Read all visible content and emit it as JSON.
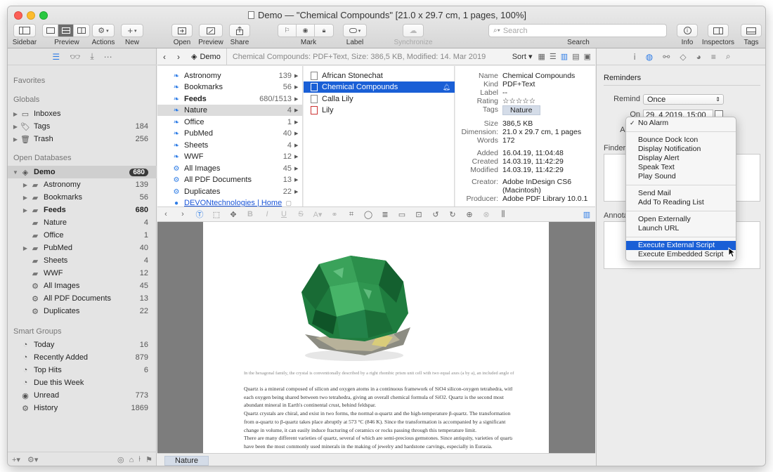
{
  "window": {
    "title": "Demo — \"Chemical Compounds\" [21.0 x 29.7 cm, 1 pages, 100%]"
  },
  "toolbar": {
    "sidebar_label": "Sidebar",
    "preview_label": "Preview",
    "actions_label": "Actions",
    "new_label": "New",
    "open_label": "Open",
    "preview2_label": "Preview",
    "share_label": "Share",
    "mark_label": "Mark",
    "label_label": "Label",
    "sync_label": "Synchronize",
    "search_placeholder": "Search",
    "search_label": "Search",
    "info_label": "Info",
    "inspectors_label": "Inspectors",
    "tags_label": "Tags"
  },
  "sidebar": {
    "favorites": "Favorites",
    "globals": "Globals",
    "global_items": [
      {
        "label": "Inboxes",
        "count": ""
      },
      {
        "label": "Tags",
        "count": "184"
      },
      {
        "label": "Trash",
        "count": "256"
      }
    ],
    "open_databases": "Open Databases",
    "database": {
      "label": "Demo",
      "count": "680"
    },
    "db_items": [
      {
        "label": "Astronomy",
        "count": "139"
      },
      {
        "label": "Bookmarks",
        "count": "56"
      },
      {
        "label": "Feeds",
        "count": "680"
      },
      {
        "label": "Nature",
        "count": "4"
      },
      {
        "label": "Office",
        "count": "1"
      },
      {
        "label": "PubMed",
        "count": "40"
      },
      {
        "label": "Sheets",
        "count": "4"
      },
      {
        "label": "WWF",
        "count": "12"
      },
      {
        "label": "All Images",
        "count": "45"
      },
      {
        "label": "All PDF Documents",
        "count": "13"
      },
      {
        "label": "Duplicates",
        "count": "22"
      }
    ],
    "smart_groups": "Smart Groups",
    "smart_items": [
      {
        "label": "Today",
        "count": "16"
      },
      {
        "label": "Recently Added",
        "count": "879"
      },
      {
        "label": "Top Hits",
        "count": "6"
      },
      {
        "label": "Due this Week",
        "count": ""
      },
      {
        "label": "Unread",
        "count": "773"
      },
      {
        "label": "History",
        "count": "1869"
      }
    ]
  },
  "navbar": {
    "crumb": "Demo",
    "info": "Chemical Compounds: PDF+Text, Size: 386,5 KB, Modified: 14. Mar 2019",
    "sort": "Sort"
  },
  "groups": [
    {
      "label": "Astronomy",
      "count": "139"
    },
    {
      "label": "Bookmarks",
      "count": "56"
    },
    {
      "label": "Feeds",
      "count": "680/1513"
    },
    {
      "label": "Nature",
      "count": "4"
    },
    {
      "label": "Office",
      "count": "1"
    },
    {
      "label": "PubMed",
      "count": "40"
    },
    {
      "label": "Sheets",
      "count": "4"
    },
    {
      "label": "WWF",
      "count": "12"
    },
    {
      "label": "All Images",
      "count": "45"
    },
    {
      "label": "All PDF Documents",
      "count": "13"
    },
    {
      "label": "Duplicates",
      "count": "22"
    },
    {
      "label": "DEVONtechnologies | Home",
      "count": ""
    }
  ],
  "documents": [
    {
      "label": "African Stonechat"
    },
    {
      "label": "Chemical Compounds"
    },
    {
      "label": "Calla Lily"
    },
    {
      "label": "Lily"
    }
  ],
  "info": {
    "name_k": "Name",
    "name_v": "Chemical Compounds",
    "kind_k": "Kind",
    "kind_v": "PDF+Text",
    "label_k": "Label",
    "label_v": "--",
    "rating_k": "Rating",
    "rating_v": "☆☆☆☆☆",
    "tags_k": "Tags",
    "tags_v": "Nature",
    "size_k": "Size",
    "size_v": "386,5 KB",
    "dim_k": "Dimension:",
    "dim_v": "21.0 x 29.7 cm, 1 pages",
    "words_k": "Words",
    "words_v": "172",
    "added_k": "Added",
    "added_v": "16.04.19, 11:04:48",
    "created_k": "Created",
    "created_v": "14.03.19, 11:42:29",
    "modified_k": "Modified",
    "modified_v": "14.03.19, 11:42:29",
    "creator_k": "Creator:",
    "creator_v": "Adobe InDesign CS6 (Macintosh)",
    "producer_k": "Producer:",
    "producer_v": "Adobe PDF Library 10.0.1"
  },
  "document": {
    "caption": "In the hexagonal family, the crystal is conventionally described by a right rhombic prism unit cell with two equal axes (a by a), an included angle of",
    "lines": [
      "Quartz is a mineral composed of silicon and oxygen atoms in a continuous framework of SiO4 silicon-oxygen tetrahedra, with",
      "each oxygen being shared between two tetrahedra, giving an overall chemical formula of SiO2. Quartz is the second most",
      "abundant mineral in Earth's continental crust, behind feldspar.",
      "Quartz crystals are chiral, and exist in two forms, the normal α-quartz and the high-temperature β-quartz. The transformation",
      "from α-quartz to β-quartz takes place abruptly at 573 °C (846 K). Since the transformation is accompanied by a significant",
      "change in volume, it can easily induce fracturing of ceramics or rocks passing through this temperature limit.",
      "There are many different varieties of quartz, several of which are semi-precious gemstones. Since antiquity, varieties of quartz",
      "have been the most commonly used minerals in the making of jewelry and hardstone carvings, especially in Eurasia."
    ]
  },
  "statusbar": {
    "tag": "Nature"
  },
  "inspector": {
    "title": "Reminders",
    "remind_label": "Remind",
    "remind_value": "Once",
    "on_label": "On",
    "on_value": "29.  4.2019, 15:00",
    "alarm_label": "Alarm",
    "finder_label": "Finder Con",
    "annotation_label": "Annotation"
  },
  "alarm_menu": {
    "items": [
      "No Alarm",
      "Bounce Dock Icon",
      "Display Notification",
      "Display Alert",
      "Speak Text",
      "Play Sound",
      "Send Mail",
      "Add To Reading List",
      "Open Externally",
      "Launch URL",
      "Execute External Script",
      "Execute Embedded Script"
    ]
  },
  "colors": {
    "accent": "#1a5fd6",
    "link": "#1a55d8",
    "tag_chip": "#d4dce8"
  }
}
